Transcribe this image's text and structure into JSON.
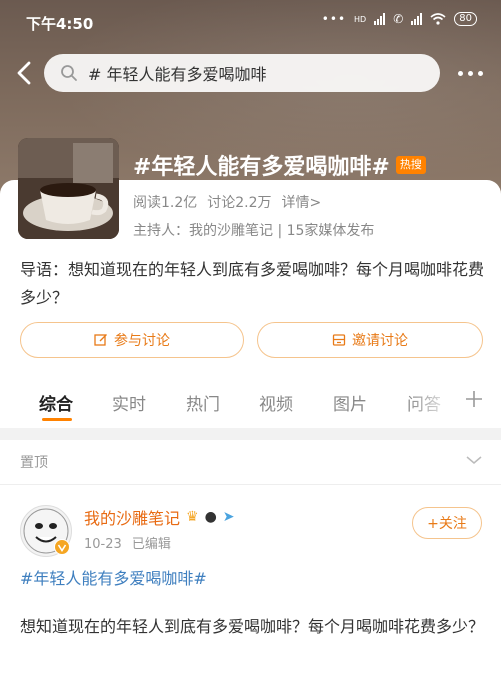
{
  "status_bar": {
    "time": "下午4:50",
    "network": "HD",
    "battery": "80"
  },
  "search": {
    "value": "# 年轻人能有多爱喝咖啡"
  },
  "topic": {
    "title": "#年轻人能有多爱喝咖啡#",
    "badge": "热搜",
    "reads": "阅读1.2亿",
    "discussions": "讨论2.2万",
    "details": "详情>",
    "host": "主持人：我的沙雕笔记 | 15家媒体发布",
    "intro": "导语：想知道现在的年轻人到底有多爱喝咖啡？每个月喝咖啡花费多少？"
  },
  "actions": {
    "join": "参与讨论",
    "invite": "邀请讨论"
  },
  "tabs": [
    "综合",
    "实时",
    "热门",
    "视频",
    "图片",
    "问答"
  ],
  "pinned": {
    "label": "置顶"
  },
  "post": {
    "author": "我的沙雕笔记",
    "date": "10-23",
    "edited": "已编辑",
    "follow": "+关注",
    "tag": "#年轻人能有多爱喝咖啡#",
    "body": "想知道现在的年轻人到底有多爱喝咖啡？每个月喝咖啡花费多少？"
  },
  "colors": {
    "accent": "#ff8200",
    "link": "#3f7fbf",
    "author": "#e86a12"
  }
}
